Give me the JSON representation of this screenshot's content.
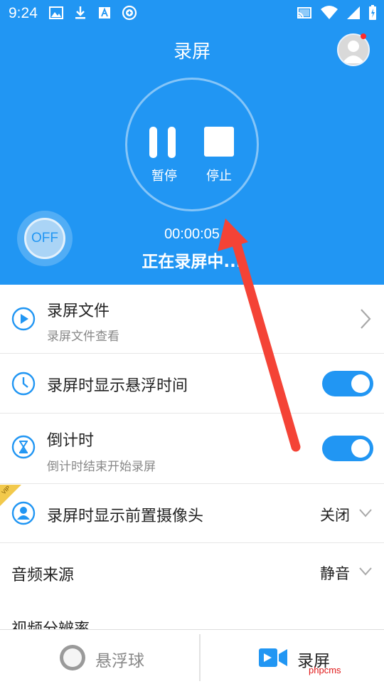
{
  "status_bar": {
    "time": "9:24"
  },
  "header": {
    "title": "录屏",
    "pause_label": "暂停",
    "stop_label": "停止",
    "floating_toggle": "OFF",
    "timer": "00:00:05",
    "recording_status": "正在录屏中..."
  },
  "list": {
    "files": {
      "title": "录屏文件",
      "subtitle": "录屏文件查看"
    },
    "show_time": {
      "title": "录屏时显示悬浮时间",
      "enabled": true
    },
    "countdown": {
      "title": "倒计时",
      "subtitle": "倒计时结束开始录屏",
      "enabled": true
    },
    "front_camera": {
      "title": "录屏时显示前置摄像头",
      "value": "关闭",
      "badge": "VIP"
    },
    "audio_source": {
      "title": "音频来源",
      "value": "静音"
    },
    "resolution": {
      "title": "视频分辨率"
    }
  },
  "bottom_nav": {
    "floating_ball": "悬浮球",
    "record": "录屏"
  },
  "watermark": "phpcms",
  "colors": {
    "primary": "#2196F3",
    "background": "#ffffff",
    "accent_red": "#F44336"
  }
}
